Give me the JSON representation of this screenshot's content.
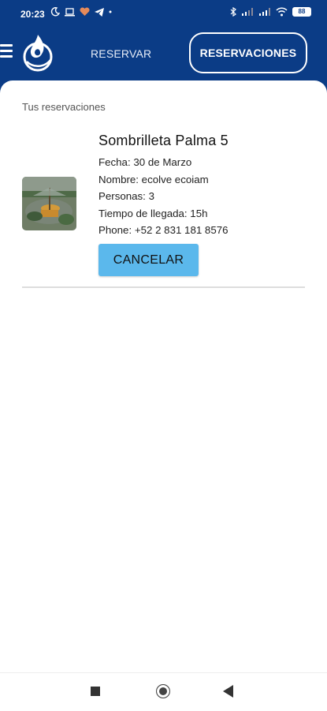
{
  "status_bar": {
    "time": "20:23",
    "battery": "88"
  },
  "header": {
    "reservar_label": "RESERVAR",
    "reservaciones_label": "RESERVACIONES"
  },
  "main": {
    "section_title": "Tus reservaciones",
    "reservations": [
      {
        "place": "Sombrilleta Palma 5",
        "fecha": "Fecha: 30 de Marzo",
        "nombre": "Nombre: ecolve ecoiam",
        "personas": "Personas: 3",
        "tiempo": "Tiempo de llegada: 15h",
        "phone": "Phone: +52 2 831 181 8576",
        "cancel_label": "CANCELAR"
      }
    ]
  },
  "colors": {
    "header_bg": "#0b3c86",
    "cancel_bg": "#5bb8ec"
  }
}
